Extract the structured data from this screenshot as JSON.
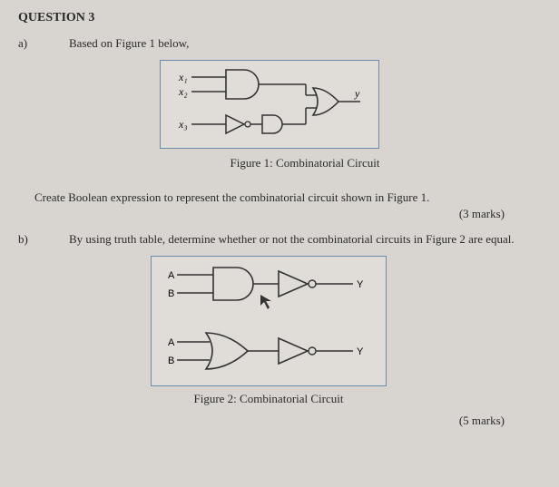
{
  "question": {
    "header": "QUESTION 3",
    "parts": {
      "a": {
        "label": "a)",
        "prompt": "Based on Figure 1 below,",
        "figure": {
          "inputs": {
            "x1": "x₁",
            "x2": "x₂",
            "x3": "x₃"
          },
          "output": "y",
          "caption": "Figure 1: Combinatorial Circuit"
        },
        "task": "Create Boolean expression to represent the combinatorial circuit shown in Figure 1.",
        "marks": "(3 marks)"
      },
      "b": {
        "label": "b)",
        "prompt": "By using truth table, determine whether or not the combinatorial circuits in Figure 2 are equal.",
        "figure": {
          "inputs": {
            "A": "A",
            "B": "B",
            "Y": "Y"
          },
          "caption": "Figure 2: Combinatorial Circuit"
        },
        "marks": "(5 marks)"
      }
    }
  },
  "chart_data": [
    {
      "type": "diagram",
      "name": "Figure 1",
      "description": "Combinatorial logic circuit",
      "inputs": [
        "x1",
        "x2",
        "x3"
      ],
      "gates": [
        {
          "type": "AND",
          "inputs": [
            "x1",
            "x2"
          ],
          "output": "g1"
        },
        {
          "type": "NOT",
          "inputs": [
            "x3"
          ],
          "output": "g2"
        },
        {
          "type": "AND-shape-buffer",
          "inputs": [
            "g2"
          ],
          "output": "g3"
        },
        {
          "type": "OR",
          "inputs": [
            "g1",
            "g3"
          ],
          "output": "y"
        }
      ],
      "output": "y"
    },
    {
      "type": "diagram",
      "name": "Figure 2",
      "description": "Two combinatorial circuits for equivalence comparison",
      "circuits": [
        {
          "inputs": [
            "A",
            "B"
          ],
          "gates": [
            {
              "type": "AND",
              "inputs": [
                "A",
                "B"
              ],
              "output": "t1"
            },
            {
              "type": "NOT-bubble-buffer",
              "inputs": [
                "t1"
              ],
              "output": "Y"
            }
          ],
          "output": "Y"
        },
        {
          "inputs": [
            "A",
            "B"
          ],
          "gates": [
            {
              "type": "OR",
              "inputs": [
                "A",
                "B"
              ],
              "output": "t2"
            },
            {
              "type": "NOT-bubble-buffer",
              "inputs": [
                "t2"
              ],
              "output": "Y"
            }
          ],
          "output": "Y"
        }
      ]
    }
  ]
}
